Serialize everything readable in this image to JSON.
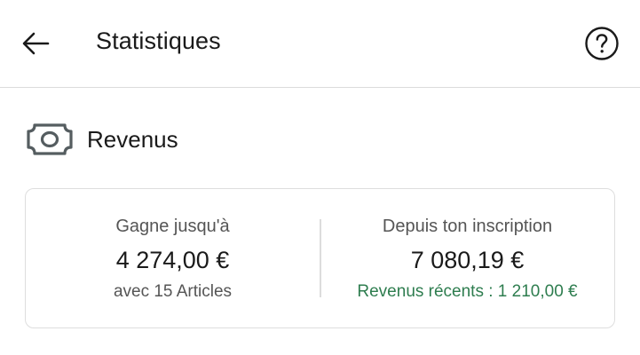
{
  "header": {
    "title": "Statistiques",
    "back_icon": "arrow-left-icon",
    "help_icon": "question-circle-icon"
  },
  "section": {
    "icon": "banknote-icon",
    "title": "Revenus"
  },
  "card": {
    "left": {
      "label": "Gagne jusqu'à",
      "value": "4 274,00 €",
      "sub": "avec 15 Articles"
    },
    "right": {
      "label": "Depuis ton inscription",
      "value": "7 080,19 €",
      "sub": "Revenus récents : 1 210,00 €"
    }
  },
  "colors": {
    "accent_green": "#2e7d4f",
    "divider": "#dcdcdc",
    "icon_gray": "#555d60"
  }
}
